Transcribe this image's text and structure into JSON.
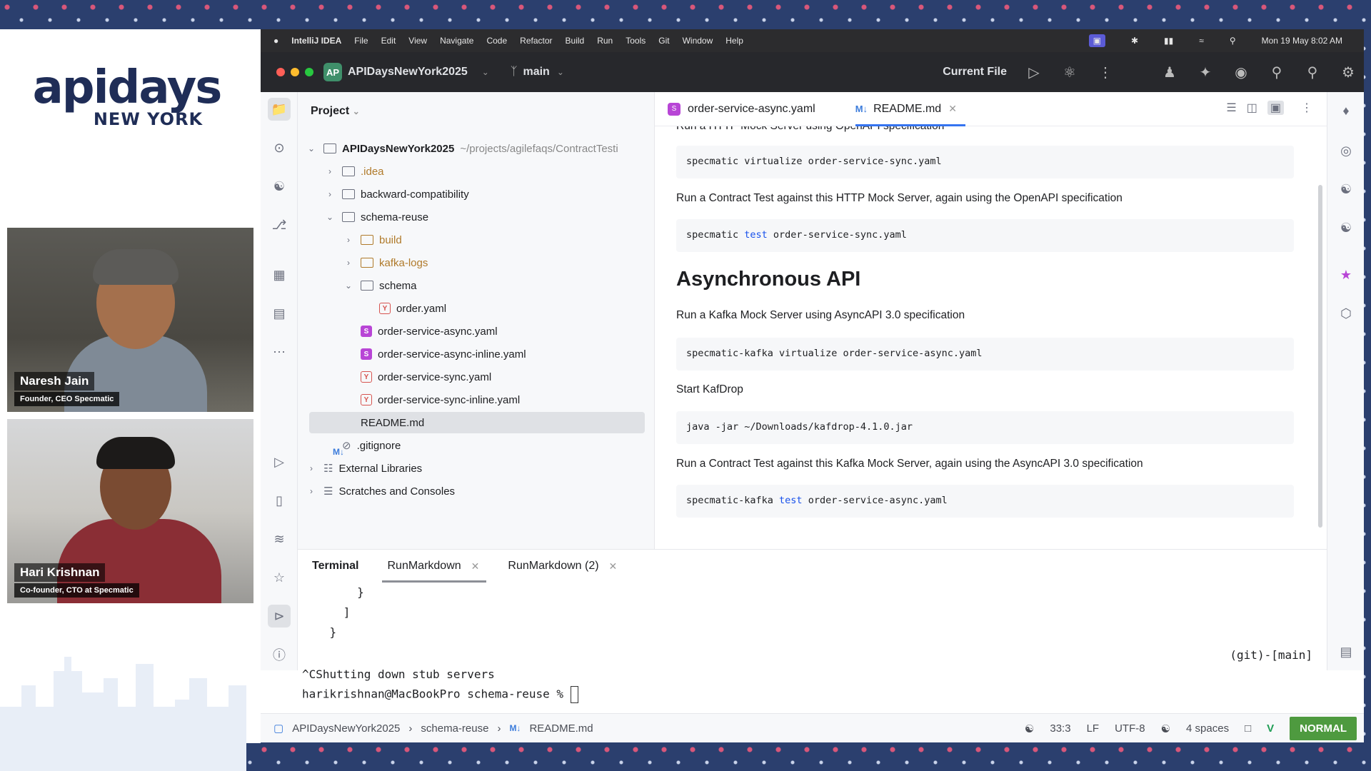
{
  "branding": {
    "logo_main": "apidays",
    "logo_sub": "NEW YORK"
  },
  "speakers": [
    {
      "name": "Naresh Jain",
      "role": "Founder, CEO Specmatic"
    },
    {
      "name": "Hari Krishnan",
      "role": "Co-founder, CTO at Specmatic"
    }
  ],
  "menubar": {
    "app": "IntelliJ IDEA",
    "items": [
      "File",
      "Edit",
      "View",
      "Navigate",
      "Code",
      "Refactor",
      "Build",
      "Run",
      "Tools",
      "Git",
      "Window",
      "Help"
    ],
    "clock": "Mon 19 May  8:02 AM"
  },
  "titlebar": {
    "project_badge": "AP",
    "project": "APIDaysNewYork2025",
    "branch": "main",
    "run_config": "Current File"
  },
  "project_panel": {
    "title": "Project",
    "tree": [
      {
        "label": "APIDaysNewYork2025",
        "extra": "~/projects/agilefaqs/ContractTesti",
        "level": 0,
        "kind": "root"
      },
      {
        "label": ".idea",
        "level": 1,
        "kind": "folder-collapsed",
        "excluded": true
      },
      {
        "label": "backward-compatibility",
        "level": 1,
        "kind": "folder-collapsed"
      },
      {
        "label": "schema-reuse",
        "level": 1,
        "kind": "folder-open"
      },
      {
        "label": "build",
        "level": 2,
        "kind": "folder-collapsed",
        "excluded": true
      },
      {
        "label": "kafka-logs",
        "level": 2,
        "kind": "folder-collapsed",
        "excluded": true
      },
      {
        "label": "schema",
        "level": 2,
        "kind": "folder-open"
      },
      {
        "label": "order.yaml",
        "level": 3,
        "kind": "yaml"
      },
      {
        "label": "order-service-async.yaml",
        "level": 2,
        "kind": "specmatic"
      },
      {
        "label": "order-service-async-inline.yaml",
        "level": 2,
        "kind": "specmatic"
      },
      {
        "label": "order-service-sync.yaml",
        "level": 2,
        "kind": "yaml"
      },
      {
        "label": "order-service-sync-inline.yaml",
        "level": 2,
        "kind": "yaml"
      },
      {
        "label": "README.md",
        "level": 2,
        "kind": "markdown",
        "selected": true
      },
      {
        "label": ".gitignore",
        "level": 1,
        "kind": "ignore"
      },
      {
        "label": "External Libraries",
        "level": 0,
        "kind": "library"
      },
      {
        "label": "Scratches and Consoles",
        "level": 0,
        "kind": "scratch"
      }
    ]
  },
  "editor": {
    "tabs": [
      {
        "label": "order-service-async.yaml",
        "active": false
      },
      {
        "label": "README.md",
        "active": true
      }
    ],
    "md_prefix": "M↓",
    "content": {
      "cut_line": "Run a HTTP Mock Server using OpenAPI specification",
      "code1": "specmatic virtualize order-service-sync.yaml",
      "p1": "Run a Contract Test against this HTTP Mock Server, again using the OpenAPI specification",
      "code2_a": "specmatic ",
      "code2_kw": "test",
      "code2_b": " order-service-sync.yaml",
      "heading": "Asynchronous API",
      "p2": "Run a Kafka Mock Server using AsyncAPI 3.0 specification",
      "code3": "specmatic-kafka virtualize order-service-async.yaml",
      "p3": "Start KafDrop",
      "code4": "java -jar ~/Downloads/kafdrop-4.1.0.jar",
      "p4": "Run a Contract Test against this Kafka Mock Server, again using the AsyncAPI 3.0 specification",
      "code5_a": "specmatic-kafka ",
      "code5_kw": "test",
      "code5_b": " order-service-async.yaml"
    }
  },
  "terminal": {
    "tabs": [
      {
        "label": "Terminal",
        "active": false
      },
      {
        "label": "RunMarkdown",
        "active": true
      },
      {
        "label": "RunMarkdown (2)",
        "active": false
      }
    ],
    "lines": [
      "        }",
      "      ]",
      "    }",
      "",
      "^CShutting down stub servers"
    ],
    "prompt": "harikrishnan@MacBookPro schema-reuse % ",
    "git_info": "(git)-[main]"
  },
  "statusbar": {
    "crumbs": [
      "APIDaysNewYork2025",
      "schema-reuse",
      "README.md"
    ],
    "position": "33:3",
    "line_ending": "LF",
    "encoding": "UTF-8",
    "indent": "4 spaces",
    "mode": "NORMAL"
  }
}
